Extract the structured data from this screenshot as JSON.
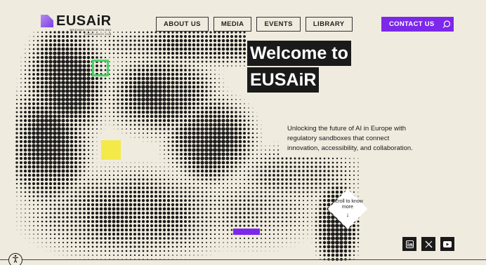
{
  "header": {
    "logo_word": "EUSAiR",
    "logo_tagline_1": "BRIDGING INNOVATION AND",
    "logo_tagline_2": "COMPLIANCE HUB",
    "nav": [
      "ABOUT US",
      "MEDIA",
      "EVENTS",
      "LIBRARY"
    ],
    "contact_label": "CONTACT US",
    "search_icon": "search-icon"
  },
  "hero": {
    "line1": "Welcome to",
    "line2": "EUSAiR",
    "subtitle": "Unlocking the future of AI in Europe with regulatory sandboxes that connect innovation, accessibility, and collaboration."
  },
  "scroll": {
    "label": "Scroll to know more",
    "icon": "arrow-down-icon"
  },
  "social": [
    "linkedin-icon",
    "x-icon",
    "youtube-icon"
  ],
  "colors": {
    "background": "#f0ebdf",
    "accent_purple": "#7b28ea",
    "accent_green": "#4ad36a",
    "accent_yellow": "#f3ea4a",
    "ink": "#1a1a1a"
  }
}
